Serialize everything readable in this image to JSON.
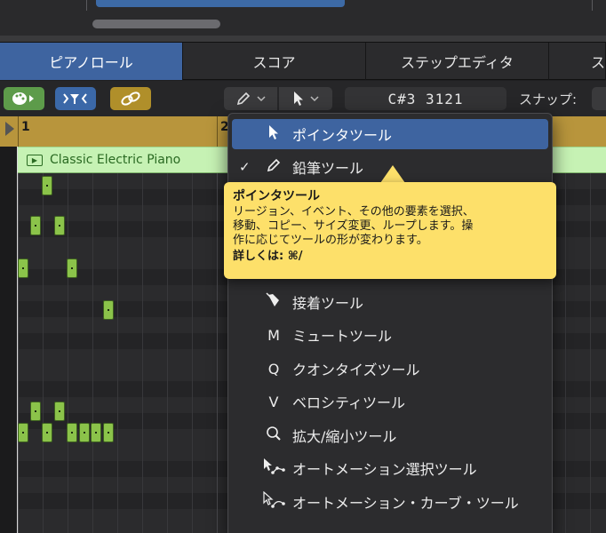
{
  "tabs": [
    {
      "label": "ピアノロール",
      "active": true
    },
    {
      "label": "スコア",
      "active": false
    },
    {
      "label": "ステップエディタ",
      "active": false
    },
    {
      "label": "ス",
      "active": false
    }
  ],
  "toolbar": {
    "position_display": "C#3  3121",
    "snap_label": "スナップ:"
  },
  "ruler": {
    "bar1": "1",
    "bar2": "2"
  },
  "region": {
    "name": "Classic Electric Piano"
  },
  "menu": {
    "items": [
      {
        "label": "ポインタツール",
        "icon": "arrow-pointer-icon",
        "selected": true,
        "checked": false
      },
      {
        "label": "鉛筆ツール",
        "icon": "pencil-icon",
        "selected": false,
        "checked": true
      },
      {
        "label": "接着ツール",
        "icon": "glue-icon",
        "selected": false,
        "checked": false
      },
      {
        "label": "ミュートツール",
        "icon_text": "M",
        "selected": false,
        "checked": false
      },
      {
        "label": "クオンタイズツール",
        "icon_text": "Q",
        "selected": false,
        "checked": false
      },
      {
        "label": "ベロシティツール",
        "icon_text": "V",
        "selected": false,
        "checked": false
      },
      {
        "label": "拡大/縮小ツール",
        "icon": "magnifier-icon",
        "selected": false,
        "checked": false
      },
      {
        "label": "オートメーション選択ツール",
        "icon": "automation-select-icon",
        "selected": false,
        "checked": false
      },
      {
        "label": "オートメーション・カーブ・ツール",
        "icon": "automation-curve-icon",
        "selected": false,
        "checked": false
      }
    ],
    "check_mark": "✓"
  },
  "tooltip": {
    "title": "ポインタツール",
    "line1": "リージョン、イベント、その他の要素を選択、",
    "line2": "移動、コピー、サイズ変更、ループします。操",
    "line3": "作に応じてツールの形が変わります。",
    "more": "詳しくは: ⌘/"
  },
  "colors": {
    "tab_active": "#3e64a0",
    "tooltip_bg": "#fde06a",
    "region_bg": "#c6f2b4",
    "note_fill": "#8bc34a",
    "ruler_bg": "#b8953c"
  }
}
